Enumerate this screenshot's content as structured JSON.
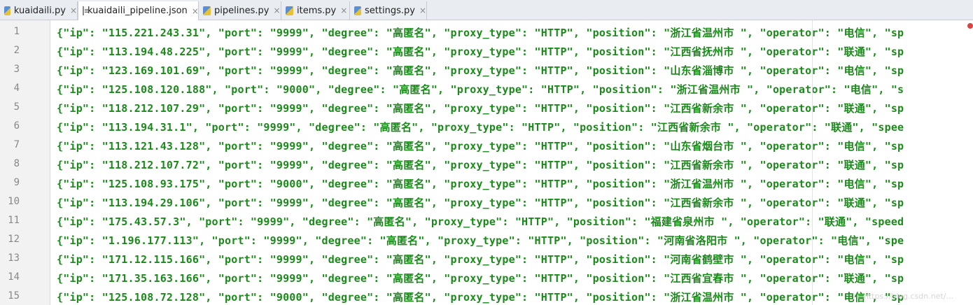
{
  "tabs": [
    {
      "label": "kuaidaili.py",
      "icon": "python-file-icon",
      "active": false
    },
    {
      "label": "kuaidaili_pipeline.json",
      "icon": "json-file-icon",
      "active": true
    },
    {
      "label": "pipelines.py",
      "icon": "python-file-icon",
      "active": false
    },
    {
      "label": "items.py",
      "icon": "python-file-icon",
      "active": false
    },
    {
      "label": "settings.py",
      "icon": "python-file-icon",
      "active": false
    }
  ],
  "close_glyph": "×",
  "lines": [
    {
      "n": "1",
      "text": "{\"ip\": \"115.221.243.31\", \"port\": \"9999\", \"degree\": \"高匿名\", \"proxy_type\": \"HTTP\", \"position\": \"浙江省温州市 \", \"operator\": \"电信\", \"sp"
    },
    {
      "n": "2",
      "text": "{\"ip\": \"113.194.48.225\", \"port\": \"9999\", \"degree\": \"高匿名\", \"proxy_type\": \"HTTP\", \"position\": \"江西省抚州市 \", \"operator\": \"联通\", \"sp"
    },
    {
      "n": "3",
      "text": "{\"ip\": \"123.169.101.69\", \"port\": \"9999\", \"degree\": \"高匿名\", \"proxy_type\": \"HTTP\", \"position\": \"山东省淄博市 \", \"operator\": \"电信\", \"sp"
    },
    {
      "n": "4",
      "text": "{\"ip\": \"125.108.120.188\", \"port\": \"9000\", \"degree\": \"高匿名\", \"proxy_type\": \"HTTP\", \"position\": \"浙江省温州市 \", \"operator\": \"电信\", \"s"
    },
    {
      "n": "5",
      "text": "{\"ip\": \"118.212.107.29\", \"port\": \"9999\", \"degree\": \"高匿名\", \"proxy_type\": \"HTTP\", \"position\": \"江西省新余市 \", \"operator\": \"联通\", \"sp"
    },
    {
      "n": "6",
      "text": "{\"ip\": \"113.194.31.1\", \"port\": \"9999\", \"degree\": \"高匿名\", \"proxy_type\": \"HTTP\", \"position\": \"江西省新余市 \", \"operator\": \"联通\", \"spee"
    },
    {
      "n": "7",
      "text": "{\"ip\": \"113.121.43.128\", \"port\": \"9999\", \"degree\": \"高匿名\", \"proxy_type\": \"HTTP\", \"position\": \"山东省烟台市 \", \"operator\": \"电信\", \"sp"
    },
    {
      "n": "8",
      "text": "{\"ip\": \"118.212.107.72\", \"port\": \"9999\", \"degree\": \"高匿名\", \"proxy_type\": \"HTTP\", \"position\": \"江西省新余市 \", \"operator\": \"联通\", \"sp"
    },
    {
      "n": "9",
      "text": "{\"ip\": \"125.108.93.175\", \"port\": \"9000\", \"degree\": \"高匿名\", \"proxy_type\": \"HTTP\", \"position\": \"浙江省温州市 \", \"operator\": \"电信\", \"sp"
    },
    {
      "n": "10",
      "text": "{\"ip\": \"113.194.29.106\", \"port\": \"9999\", \"degree\": \"高匿名\", \"proxy_type\": \"HTTP\", \"position\": \"江西省新余市 \", \"operator\": \"联通\", \"sp"
    },
    {
      "n": "11",
      "text": "{\"ip\": \"175.43.57.3\", \"port\": \"9999\", \"degree\": \"高匿名\", \"proxy_type\": \"HTTP\", \"position\": \"福建省泉州市 \", \"operator\": \"联通\", \"speed"
    },
    {
      "n": "12",
      "text": "{\"ip\": \"1.196.177.113\", \"port\": \"9999\", \"degree\": \"高匿名\", \"proxy_type\": \"HTTP\", \"position\": \"河南省洛阳市 \", \"operator\": \"电信\", \"spe"
    },
    {
      "n": "13",
      "text": "{\"ip\": \"171.12.115.166\", \"port\": \"9999\", \"degree\": \"高匿名\", \"proxy_type\": \"HTTP\", \"position\": \"河南省鹤壁市 \", \"operator\": \"电信\", \"sp"
    },
    {
      "n": "14",
      "text": "{\"ip\": \"171.35.163.166\", \"port\": \"9999\", \"degree\": \"高匿名\", \"proxy_type\": \"HTTP\", \"position\": \"江西省宜春市 \", \"operator\": \"联通\", \"sp"
    },
    {
      "n": "15",
      "text": "{\"ip\": \"125.108.72.128\", \"port\": \"9000\", \"degree\": \"高匿名\", \"proxy_type\": \"HTTP\", \"position\": \"浙江省温州市 \", \"operator\": \"电信\", \"sp"
    }
  ],
  "colors": {
    "code": "#1b8a1b",
    "gutter_bg": "#f2f2f2",
    "tabbar_bg": "#e9ecf0",
    "error_mark": "#d64545"
  },
  "watermark": "https://blog.csdn.net/..."
}
